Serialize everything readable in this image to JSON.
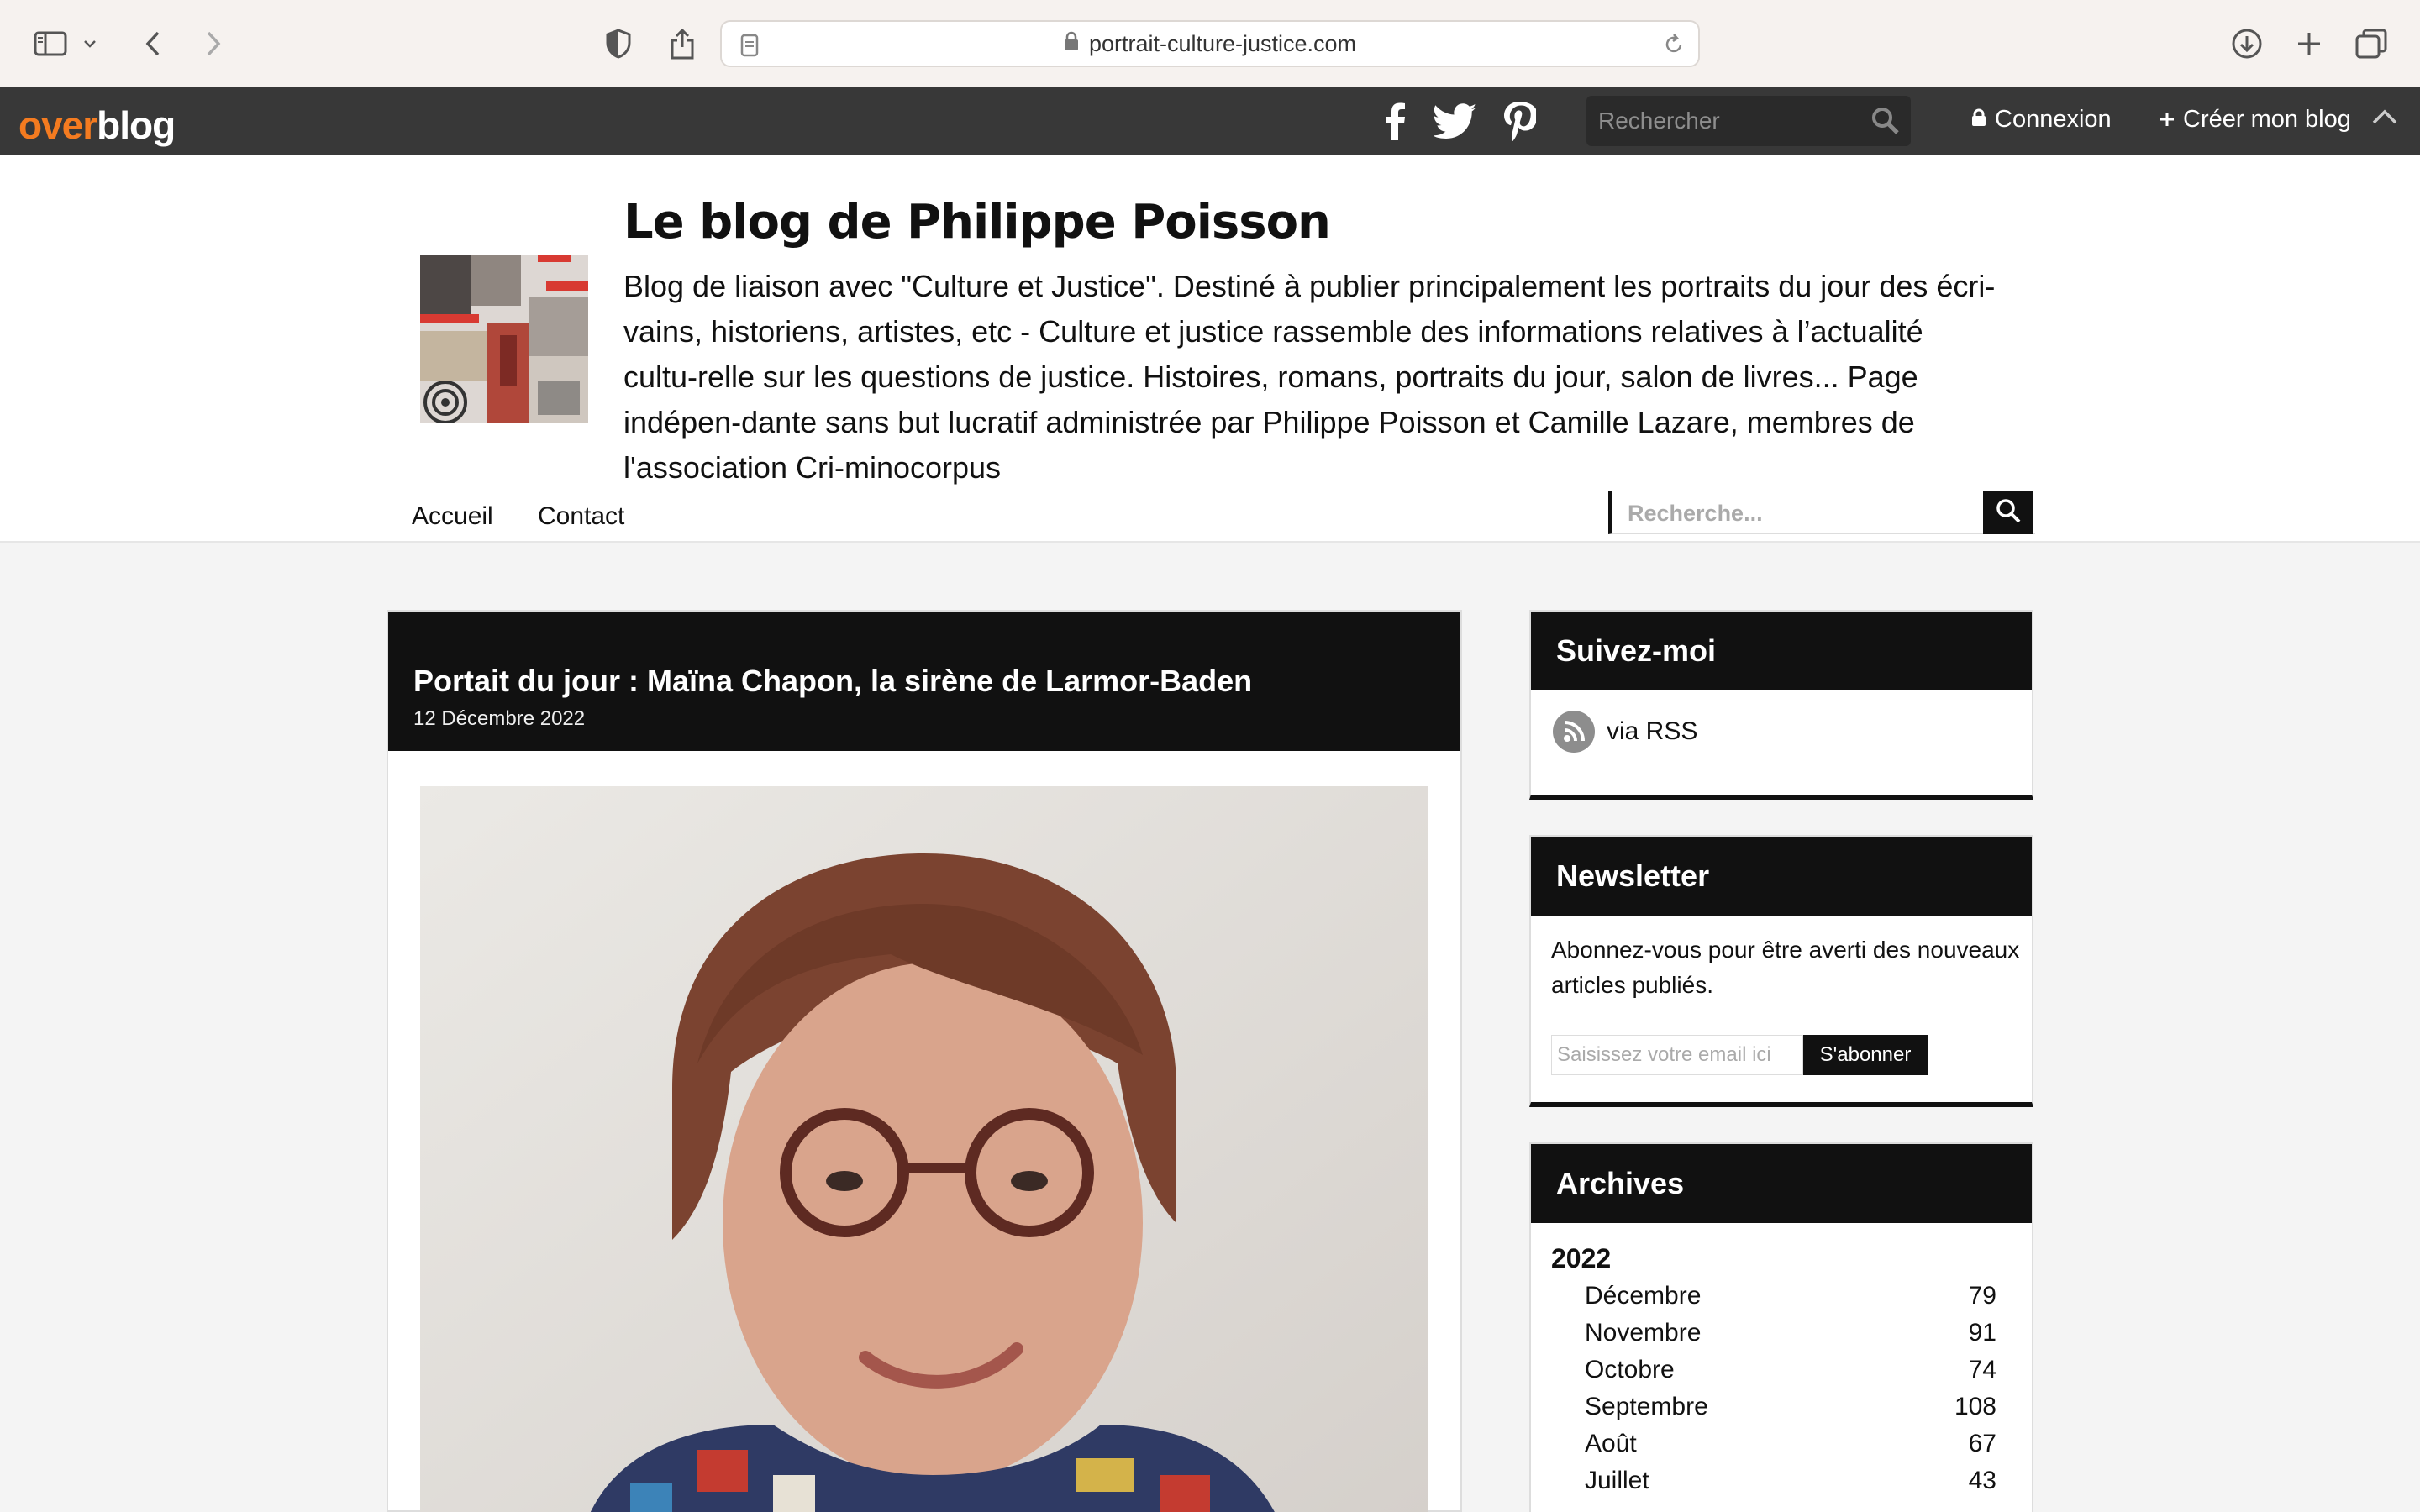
{
  "browser": {
    "url": "portrait-culture-justice.com",
    "icons": [
      "sidebar-icon",
      "chevron-down-icon",
      "back-arrow-icon",
      "forward-arrow-icon",
      "privacy-shield-icon",
      "share-icon",
      "page-icon",
      "lock-icon",
      "reload-icon",
      "download-icon",
      "plus-icon",
      "tabs-overview-icon"
    ]
  },
  "overblog": {
    "logo_over": "over",
    "logo_blog": "blog",
    "search_placeholder": "Rechercher",
    "login_label": "Connexion",
    "create_label": "Créer mon blog",
    "social_icons": [
      "facebook-icon",
      "twitter-icon",
      "pinterest-icon"
    ],
    "accent_color": "#f47b20"
  },
  "blog": {
    "title": "Le blog de Philippe Poisson",
    "description": "Blog de liaison avec \"Culture et Justice\". Destiné à publier principalement les portraits du jour des écri-vains, historiens, artistes, etc - Culture et justice rassemble des informations relatives à l’actualité cultu-relle sur les questions de justice. Histoires, romans, portraits du jour, salon de livres... Page indépen-dante sans but lucratif administrée par Philippe Poisson et Camille Lazare, membres de l'association Cri-minocorpus",
    "nav": [
      "Accueil",
      "Contact"
    ],
    "search_placeholder": "Recherche..."
  },
  "article": {
    "title": "Portait du jour : Maïna Chapon, la sirène de Larmor-Baden",
    "date": "12 Décembre 2022"
  },
  "sidebar": {
    "follow": {
      "title": "Suivez-moi",
      "rss_label": "via RSS"
    },
    "newsletter": {
      "title": "Newsletter",
      "text": "Abonnez-vous pour être averti des nouveaux articles publiés.",
      "email_placeholder": "Saisissez votre email ici",
      "subscribe_label": "S'abonner"
    },
    "archives": {
      "title": "Archives",
      "year": "2022",
      "months": [
        {
          "name": "Décembre",
          "count": "79"
        },
        {
          "name": "Novembre",
          "count": "91"
        },
        {
          "name": "Octobre",
          "count": "74"
        },
        {
          "name": "Septembre",
          "count": "108"
        },
        {
          "name": "Août",
          "count": "67"
        },
        {
          "name": "Juillet",
          "count": "43"
        }
      ]
    }
  }
}
